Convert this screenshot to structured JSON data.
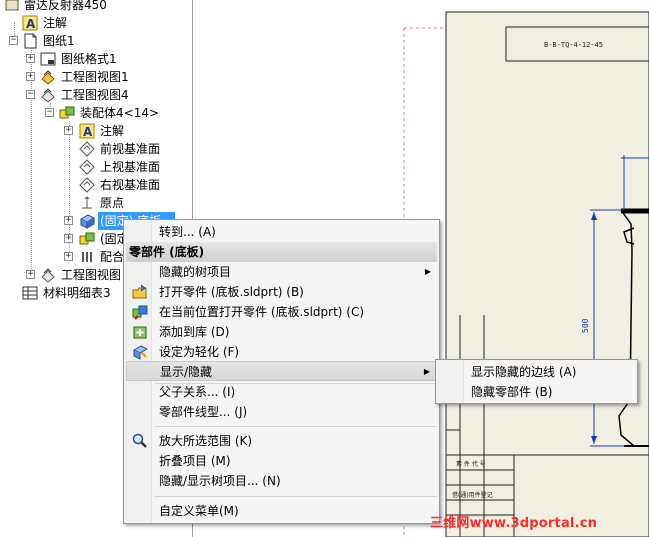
{
  "tree": {
    "items": [
      {
        "label": "雷达反射器450",
        "icon": "part-root-icon"
      },
      {
        "label": "注解",
        "icon": "annotation-icon"
      },
      {
        "label": "图纸1",
        "icon": "sheet-icon"
      },
      {
        "label": "图纸格式1",
        "icon": "sheet-format-icon"
      },
      {
        "label": "工程图视图1",
        "icon": "drawing-view-icon"
      },
      {
        "label": "工程图视图4",
        "icon": "drawing-view-icon"
      },
      {
        "label": "装配体4<14>",
        "icon": "assembly-icon"
      },
      {
        "label": "注解",
        "icon": "annotation-icon"
      },
      {
        "label": "前视基准面",
        "icon": "plane-icon"
      },
      {
        "label": "上视基准面",
        "icon": "plane-icon"
      },
      {
        "label": "右视基准面",
        "icon": "plane-icon"
      },
      {
        "label": "原点",
        "icon": "origin-icon"
      },
      {
        "label": "(固定) 底板...",
        "icon": "part-icon"
      },
      {
        "label": "(固定...",
        "icon": "part-icon"
      },
      {
        "label": "配合",
        "icon": "mates-icon"
      },
      {
        "label": "工程图视图",
        "icon": "drawing-view-icon"
      },
      {
        "label": "材料明细表3",
        "icon": "bom-icon"
      }
    ]
  },
  "context_menu": {
    "goto": "转到... (A)",
    "header": "零部件 (底板)",
    "hidden_tree_items": "隐藏的树项目",
    "open_part": "打开零件 (底板.sldprt) (B)",
    "open_part_in_place": "在当前位置打开零件 (底板.sldprt) (C)",
    "add_to_library": "添加到库 (D)",
    "set_lightweight": "设定为轻化 (F)",
    "show_hide": "显示/隐藏",
    "parent_child": "父子关系... (I)",
    "component_line_font": "零部件线型... (J)",
    "zoom_to_selection": "放大所选范围 (K)",
    "collapse_items": "折叠项目 (M)",
    "hide_show_tree_items": "隐藏/显示树项目... (N)",
    "customize_menu": "自定义菜单(M)"
  },
  "submenu": {
    "show_hidden_edges": "显示隐藏的边线 (A)",
    "hide_component": "隐藏零部件 (B)"
  },
  "drawing": {
    "title_code": "B-B-TQ-4-12-45",
    "dimension": "500",
    "table_text_1": "素 件 代 号",
    "table_text_2": "借(通)用件登记"
  },
  "watermark": "三维网www.3dportal.cn",
  "colors": {
    "selection": "#3399ff",
    "sheet_bg": "#f0efe2",
    "dimension_blue": "#1a3aa8",
    "watermark": "#ff2a2a"
  }
}
